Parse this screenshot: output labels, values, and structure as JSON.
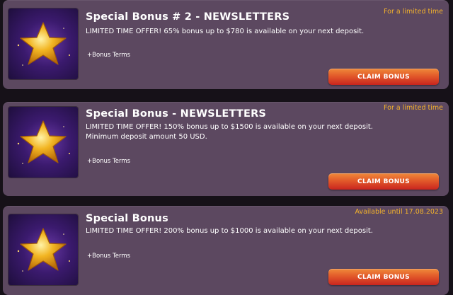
{
  "colors": {
    "card_bg": "#5c4860",
    "page_bg": "#161118",
    "badge_text": "#f3b22c",
    "button_gradient_top": "#f08a3a",
    "button_gradient_bottom": "#c9251f",
    "thumb_bg": "#3b1a6e",
    "star": "#f2b522"
  },
  "bonuses": [
    {
      "icon": "star-icon",
      "title": "Special Bonus # 2 - NEWSLETTERS",
      "description": "LIMITED TIME OFFER! 65% bonus up to $780 is available on your next deposit.",
      "terms_label": "+Bonus Terms",
      "availability": "For a limited time",
      "button_label": "CLAIM BONUS"
    },
    {
      "icon": "star-icon",
      "title": "Special Bonus - NEWSLETTERS",
      "description": "LIMITED TIME OFFER! 150% bonus up to $1500 is available on your next deposit. Minimum deposit amount 50 USD.",
      "terms_label": "+Bonus Terms",
      "availability": "For a limited time",
      "button_label": "CLAIM BONUS"
    },
    {
      "icon": "star-icon",
      "title": "Special Bonus",
      "description": "LIMITED TIME OFFER! 200% bonus up to $1000 is available on your next deposit.",
      "terms_label": "+Bonus Terms",
      "availability": "Available until 17.08.2023",
      "button_label": "CLAIM BONUS"
    }
  ]
}
